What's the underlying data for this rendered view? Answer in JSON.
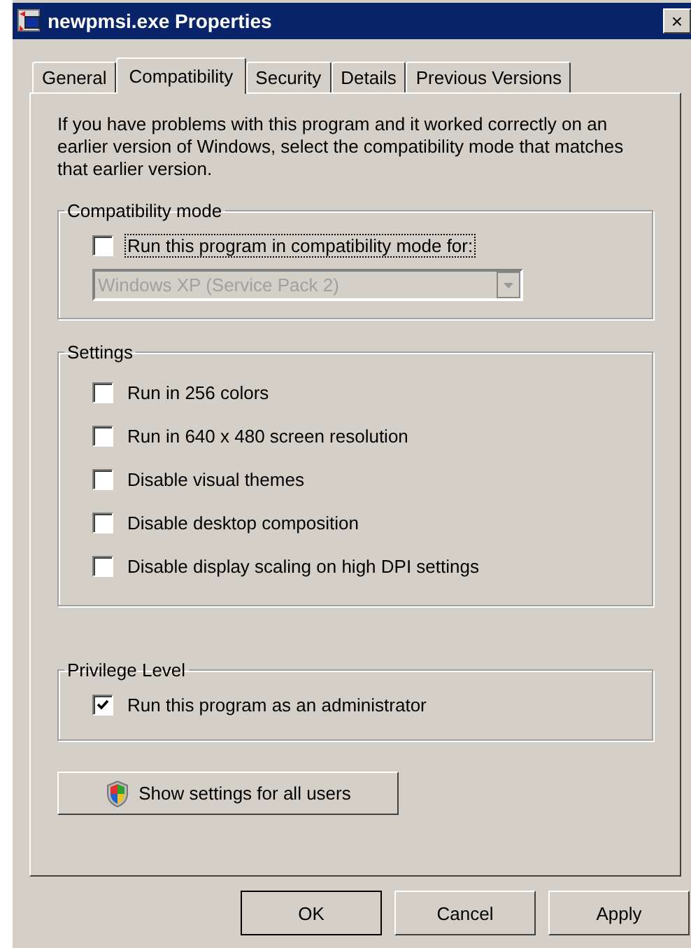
{
  "window": {
    "title": "newpmsi.exe Properties",
    "close": "×"
  },
  "tabs": [
    {
      "label": "General",
      "selected": false
    },
    {
      "label": "Compatibility",
      "selected": true
    },
    {
      "label": "Security",
      "selected": false
    },
    {
      "label": "Details",
      "selected": false
    },
    {
      "label": "Previous Versions",
      "selected": false
    }
  ],
  "intro": "If you have problems with this program and it worked correctly on an earlier version of Windows, select the compatibility mode that matches that earlier version.",
  "compatibility_mode": {
    "title": "Compatibility mode",
    "checkbox": {
      "label": "Run this program in compatibility mode for:",
      "checked": false,
      "focused": true
    },
    "dropdown": {
      "value": "Windows XP (Service Pack 2)",
      "disabled": true
    }
  },
  "settings": {
    "title": "Settings",
    "items": [
      {
        "label": "Run in 256 colors",
        "checked": false
      },
      {
        "label": "Run in 640 x 480 screen resolution",
        "checked": false
      },
      {
        "label": "Disable visual themes",
        "checked": false
      },
      {
        "label": "Disable desktop composition",
        "checked": false
      },
      {
        "label": "Disable display scaling on high DPI settings",
        "checked": false
      }
    ]
  },
  "privilege_level": {
    "title": "Privilege Level",
    "items": [
      {
        "label": "Run this program as an administrator",
        "checked": true
      }
    ]
  },
  "all_users_button": "Show settings for all users",
  "buttons": [
    {
      "label": "OK",
      "default": true
    },
    {
      "label": "Cancel",
      "default": false
    },
    {
      "label": "Apply",
      "default": false
    }
  ]
}
